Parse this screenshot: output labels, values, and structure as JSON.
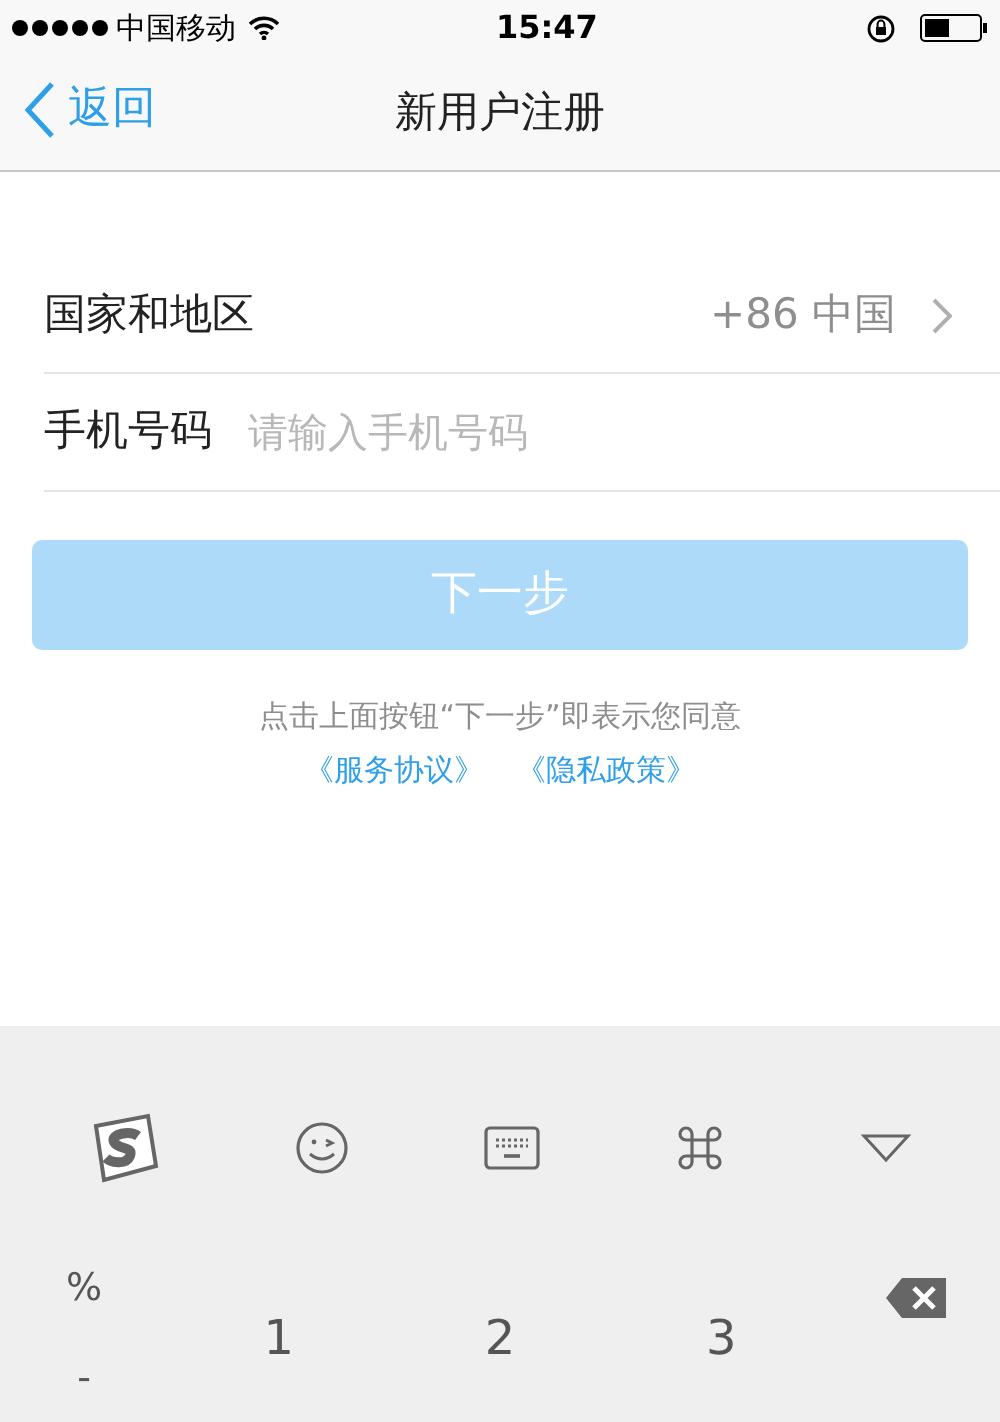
{
  "status_bar": {
    "carrier": "中国移动",
    "time": "15:47"
  },
  "nav": {
    "back": "返回",
    "title": "新用户注册"
  },
  "form": {
    "country": {
      "label": "国家和地区",
      "value": "+86 中国"
    },
    "phone": {
      "label": "手机号码",
      "placeholder": "请输入手机号码"
    }
  },
  "next_button": {
    "label": "下一步",
    "disabled": true
  },
  "agreement": {
    "text": "点击上面按钮“下一步”即表示您同意",
    "links": [
      "《服务协议》",
      "《隐私政策》"
    ]
  },
  "keyboard": {
    "symbols": [
      "%",
      "-"
    ],
    "keys": [
      "1",
      "2",
      "3"
    ]
  }
}
